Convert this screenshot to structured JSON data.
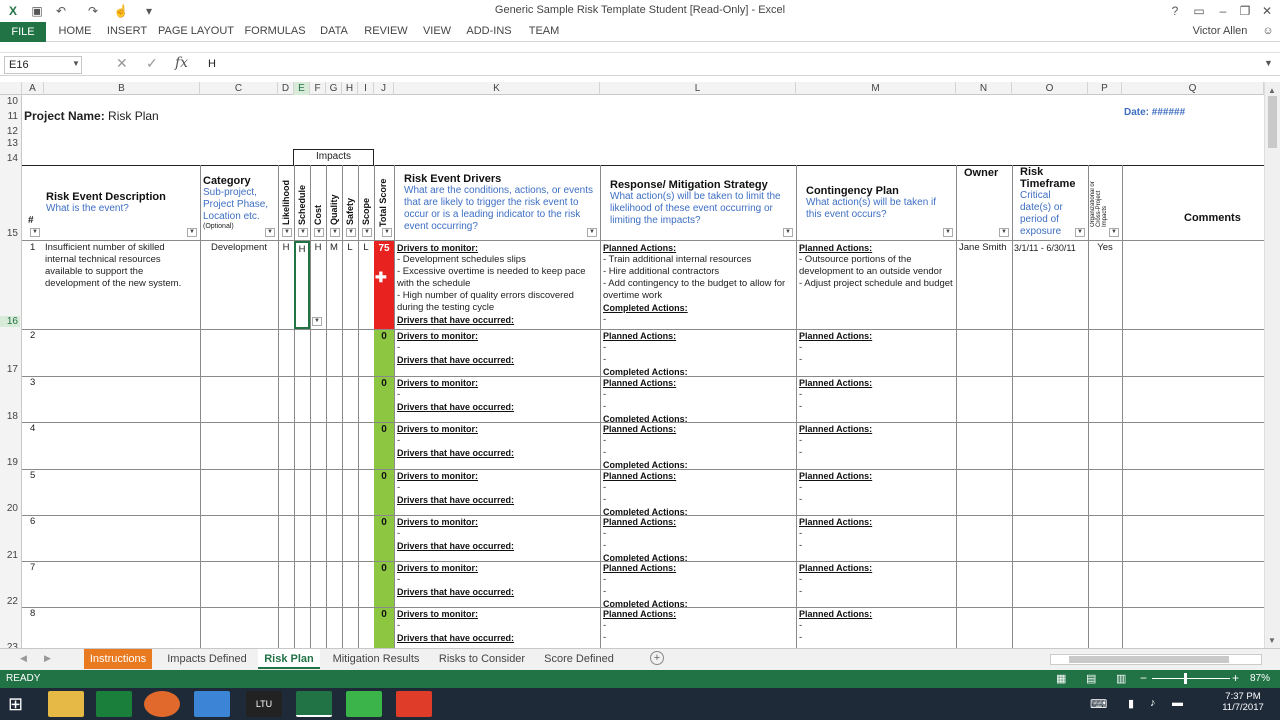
{
  "window": {
    "title": "Generic Sample Risk Template Student  [Read-Only] - Excel",
    "user": "Victor Allen"
  },
  "ribbon": {
    "tabs": [
      "FILE",
      "HOME",
      "INSERT",
      "PAGE LAYOUT",
      "FORMULAS",
      "DATA",
      "REVIEW",
      "VIEW",
      "ADD-INS",
      "TEAM"
    ]
  },
  "formula": {
    "namebox": "E16",
    "value": "H"
  },
  "columns": [
    "A",
    "B",
    "C",
    "D",
    "E",
    "F",
    "G",
    "H",
    "I",
    "J",
    "K",
    "L",
    "M",
    "N",
    "O",
    "P",
    "Q"
  ],
  "rows": [
    "10",
    "11",
    "12",
    "13",
    "14",
    "15",
    "16",
    "17",
    "18",
    "19",
    "20",
    "21",
    "22",
    "23"
  ],
  "sheet": {
    "project_label": "Project Name:",
    "project_value": "Risk Plan",
    "date_label": "Date:",
    "date_value": "######",
    "impacts": "Impacts",
    "headers": {
      "num": "#",
      "desc_title": "Risk Event Description",
      "desc_sub": "What is the event?",
      "cat_title": "Category",
      "cat_sub": "Sub-project, Project Phase, Location etc.",
      "cat_opt": "(Optional)",
      "likelihood": "Likelihood",
      "schedule": "Schedule",
      "cost": "Cost",
      "quality": "Quality",
      "safety": "Safety",
      "scope": "Scope",
      "total": "Total Score",
      "drivers_title": "Risk Event Drivers",
      "drivers_sub": "What are the conditions, actions, or events that are likely to trigger the risk event to occur or is a leading indicator to the risk event occurring?",
      "resp_title": "Response/ Mitigation Strategy",
      "resp_sub": "What action(s) will be taken to limit the likelihood of these event occurring or limiting the impacts?",
      "cont_title": "Contingency Plan",
      "cont_sub": "What action(s) will be taken if this event occurs?",
      "owner": "Owner",
      "tf_title": "Risk Timeframe",
      "tf_sub": "Critical date(s) or period of exposure",
      "org": "Organizational or Cross-Project Impacts",
      "comments": "Comments"
    },
    "risk1": {
      "num": "1",
      "desc": "Insufficient number of skilled internal technical  resources available to support the development of the new system.",
      "category": "Development",
      "likelihood": "H",
      "schedule": "H",
      "cost": "H",
      "quality": "M",
      "safety": "L",
      "scope": "L",
      "total": "75",
      "drivers_monitor": "Drivers to monitor:",
      "drivers_lines": [
        "- Development schedules slips",
        "- Excessive overtime is needed to keep pace with the schedule",
        "- High number of quality errors discovered during the testing cycle"
      ],
      "drivers_occurred": "Drivers that have occurred:",
      "planned": "Planned Actions:",
      "planned_lines": [
        "- Train additional internal resources",
        "- Hire additional contractors",
        "- Add contingency to the budget to allow for overtime work"
      ],
      "completed": "Completed Actions:",
      "cont_planned": "Planned Actions:",
      "cont_lines": [
        "- Outsource portions of the development to an outside vendor",
        "- Adjust project schedule and budget"
      ],
      "owner": "Jane Smith",
      "timeframe": "3/1/11 - 6/30/11",
      "org": "Yes"
    },
    "empty_rows": [
      {
        "num": "2",
        "total": "0"
      },
      {
        "num": "3",
        "total": "0"
      },
      {
        "num": "4",
        "total": "0"
      },
      {
        "num": "5",
        "total": "0"
      },
      {
        "num": "6",
        "total": "0"
      },
      {
        "num": "7",
        "total": "0"
      },
      {
        "num": "8",
        "total": "0"
      }
    ],
    "labels": {
      "monitor": "Drivers to monitor:",
      "occurred": "Drivers that have occurred:",
      "planned": "Planned Actions:",
      "completed": "Completed Actions:",
      "dash": "-"
    }
  },
  "sheets": {
    "tabs": [
      "Instructions",
      "Impacts Defined",
      "Risk Plan",
      "Mitigation Results",
      "Risks to Consider",
      "Score Defined"
    ],
    "active": "Risk Plan"
  },
  "status": {
    "ready": "READY",
    "zoom": "87%"
  },
  "taskbar": {
    "time": "7:37 PM",
    "date": "11/7/2017"
  },
  "colors": {
    "excel_green": "#217346",
    "red_score": "#e8231f",
    "green_score": "#8dc641",
    "orange_tab": "#e97a1f"
  }
}
